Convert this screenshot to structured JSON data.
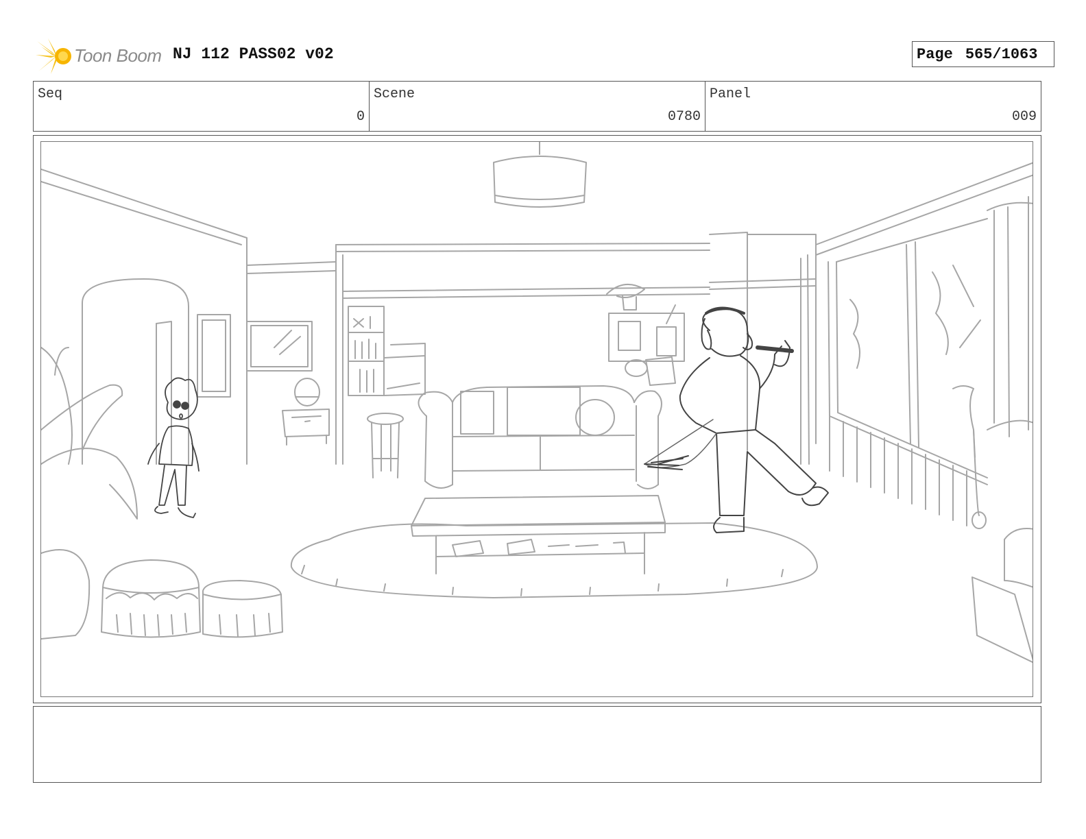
{
  "header": {
    "logo_text": "Toon Boom",
    "project_title": "NJ 112 PASS02 v02",
    "page_label": "Page",
    "page_value": "565/1063"
  },
  "info": {
    "seq_label": "Seq",
    "seq_value": "0",
    "scene_label": "Scene",
    "scene_value": "0780",
    "panel_label": "Panel",
    "panel_value": "009"
  },
  "colors": {
    "sketch_line": "#a6a6a6",
    "character_line": "#444444",
    "logo_accent": "#f5c21b"
  },
  "icons": {
    "logo": "starburst-logo-icon"
  }
}
